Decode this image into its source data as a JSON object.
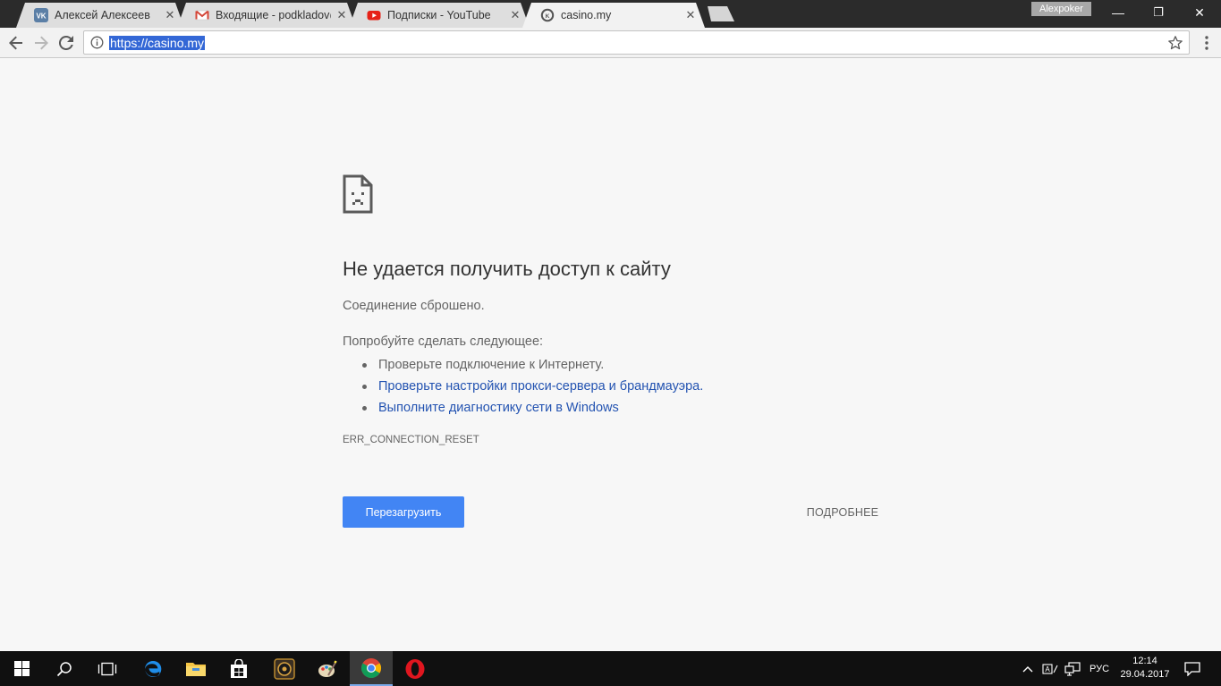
{
  "browser": {
    "tabs": [
      {
        "title": "Алексей Алексеев",
        "favicon": "vk-icon"
      },
      {
        "title": "Входящие - podkladov@",
        "favicon": "gmail-icon"
      },
      {
        "title": "Подписки - YouTube",
        "favicon": "youtube-icon"
      },
      {
        "title": "casino.my",
        "favicon": "casino-site-icon",
        "active": true
      }
    ],
    "close_glyph": "✕",
    "profile_name": "Alexpoker",
    "window_controls": {
      "minimize": "—",
      "restore": "❐",
      "close": "✕"
    },
    "url": "https://casino.my"
  },
  "error_page": {
    "heading": "Не удается получить доступ к сайту",
    "message": "Соединение сброшено.",
    "try_label": "Попробуйте сделать следующее:",
    "suggestions": [
      {
        "text": "Проверьте подключение к Интернету.",
        "link": false
      },
      {
        "text": "Проверьте настройки прокси-сервера и брандмауэра.",
        "link": true
      },
      {
        "text": "Выполните диагностику сети в Windows",
        "link": true
      }
    ],
    "error_code": "ERR_CONNECTION_RESET",
    "reload_label": "Перезагрузить",
    "details_label": "ПОДРОБНЕЕ"
  },
  "taskbar": {
    "language": "РУС",
    "time": "12:14",
    "date": "29.04.2017"
  },
  "colors": {
    "primary_button": "#4285f4",
    "link": "#2353b1",
    "url_highlight": "#3367d6",
    "taskbar": "#101010"
  }
}
